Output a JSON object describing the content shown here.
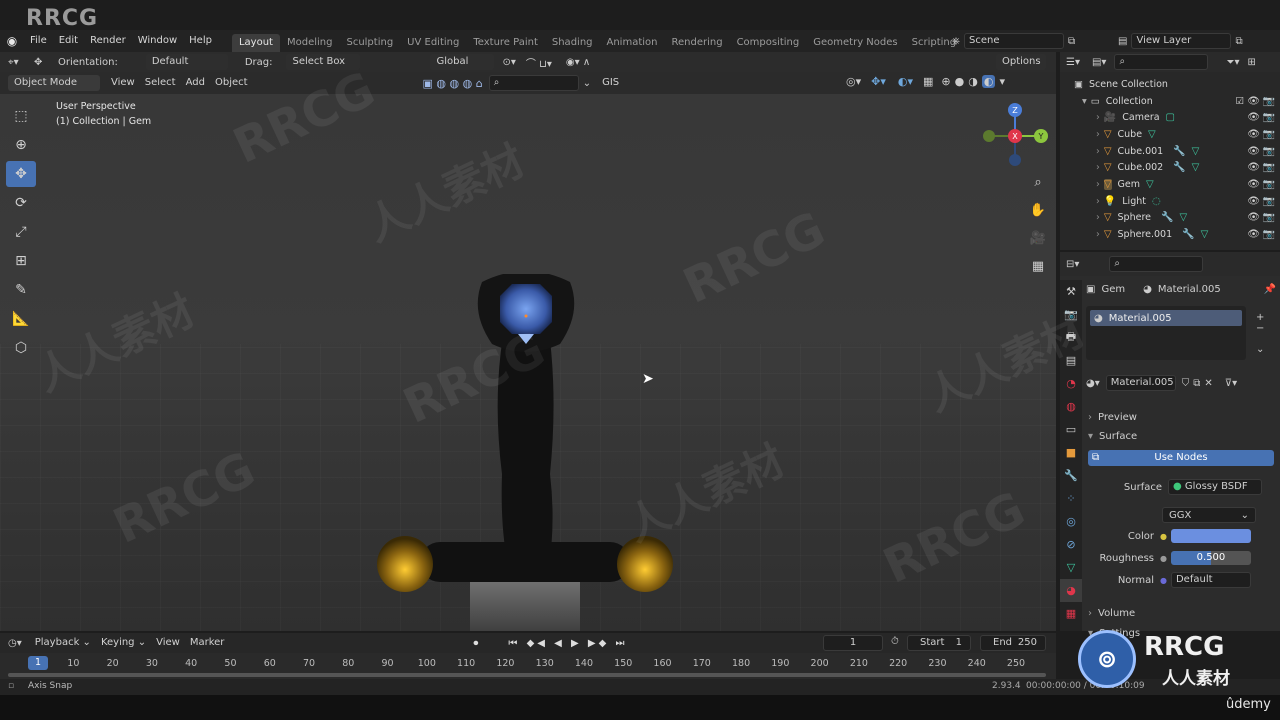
{
  "watermark_logo_text": "RRCG",
  "menu": {
    "items": [
      "File",
      "Edit",
      "Render",
      "Window",
      "Help"
    ],
    "workspaces": [
      "Layout",
      "Modeling",
      "Sculpting",
      "UV Editing",
      "Texture Paint",
      "Shading",
      "Animation",
      "Rendering",
      "Compositing",
      "Geometry Nodes",
      "Scripting"
    ],
    "active_workspace": "Layout",
    "scene_name": "Scene",
    "view_layer": "View Layer"
  },
  "toolheader": {
    "orientation_label": "Orientation:",
    "orientation_value": "Default",
    "drag_label": "Drag:",
    "drag_value": "Select Box",
    "transform_orientation": "Global",
    "options_label": "Options"
  },
  "viewheader": {
    "mode": "Object Mode",
    "menus": [
      "View",
      "Select",
      "Add",
      "Object"
    ],
    "gis_label": "GIS"
  },
  "viewport": {
    "perspective_label": "User Perspective",
    "collection_label": "(1) Collection | Gem"
  },
  "outliner": {
    "root": "Scene Collection",
    "collection": "Collection",
    "objects": [
      "Camera",
      "Cube",
      "Cube.001",
      "Cube.002",
      "Gem",
      "Light",
      "Sphere",
      "Sphere.001"
    ]
  },
  "properties": {
    "object_name": "Gem",
    "material_name": "Material.005",
    "slot_material": "Material.005",
    "datablock_material": "Material.005",
    "preview_label": "Preview",
    "surface_section": "Surface",
    "use_nodes_label": "Use Nodes",
    "surface_label": "Surface",
    "surface_value": "Glossy BSDF",
    "distribution": "GGX",
    "color_label": "Color",
    "color_hex": "#6b8fe0",
    "roughness_label": "Roughness",
    "roughness_value": "0.500",
    "normal_label": "Normal",
    "normal_value": "Default",
    "volume_section": "Volume",
    "settings_section": "Settings"
  },
  "timeline": {
    "menus": [
      "Playback",
      "Keying",
      "View",
      "Marker"
    ],
    "current_frame": "1",
    "start_label": "Start",
    "start_value": "1",
    "end_label": "End",
    "end_value": "250",
    "ticks": [
      "1",
      "10",
      "20",
      "30",
      "40",
      "50",
      "60",
      "70",
      "80",
      "90",
      "100",
      "110",
      "120",
      "130",
      "140",
      "150",
      "160",
      "170",
      "180",
      "190",
      "200",
      "210",
      "220",
      "230",
      "240",
      "250"
    ]
  },
  "status": {
    "left": "Axis Snap",
    "version": "2.93.4",
    "time": "00:00:00:00 / 00:00:10:09"
  },
  "brand": {
    "udemy": "ûdemy",
    "logo_en": "RRCG",
    "logo_cn": "人人素材"
  }
}
